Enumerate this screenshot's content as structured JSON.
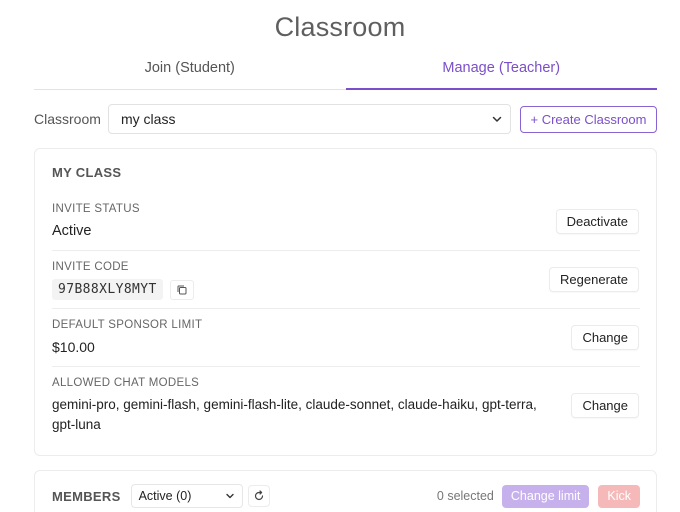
{
  "page": {
    "title": "Classroom"
  },
  "tabs": [
    {
      "label": "Join (Student)",
      "active": false
    },
    {
      "label": "Manage (Teacher)",
      "active": true
    }
  ],
  "classroom_selector": {
    "label": "Classroom",
    "selected": "my class",
    "create_label": "+ Create Classroom"
  },
  "class_card": {
    "title": "MY CLASS",
    "invite_status": {
      "label": "INVITE STATUS",
      "value": "Active",
      "action": "Deactivate"
    },
    "invite_code": {
      "label": "INVITE CODE",
      "value": "97B88XLY8MYT",
      "action": "Regenerate"
    },
    "sponsor_limit": {
      "label": "DEFAULT SPONSOR LIMIT",
      "value": "$10.00",
      "action": "Change"
    },
    "chat_models": {
      "label": "ALLOWED CHAT MODELS",
      "value": "gemini-pro, gemini-flash, gemini-flash-lite, claude-sonnet, claude-haiku, gpt-terra, gpt-luna",
      "action": "Change"
    }
  },
  "members": {
    "title": "MEMBERS",
    "filter": "Active (0)",
    "selected_text": "0 selected",
    "change_limit_label": "Change limit",
    "kick_label": "Kick"
  },
  "colors": {
    "accent": "#7b4fc9",
    "change_limit_disabled": "#c7b1ec",
    "kick_disabled": "#f5b9b9"
  },
  "icons": {
    "select_chevron": "chevron-down-icon",
    "copy": "copy-icon",
    "refresh": "refresh-icon"
  }
}
